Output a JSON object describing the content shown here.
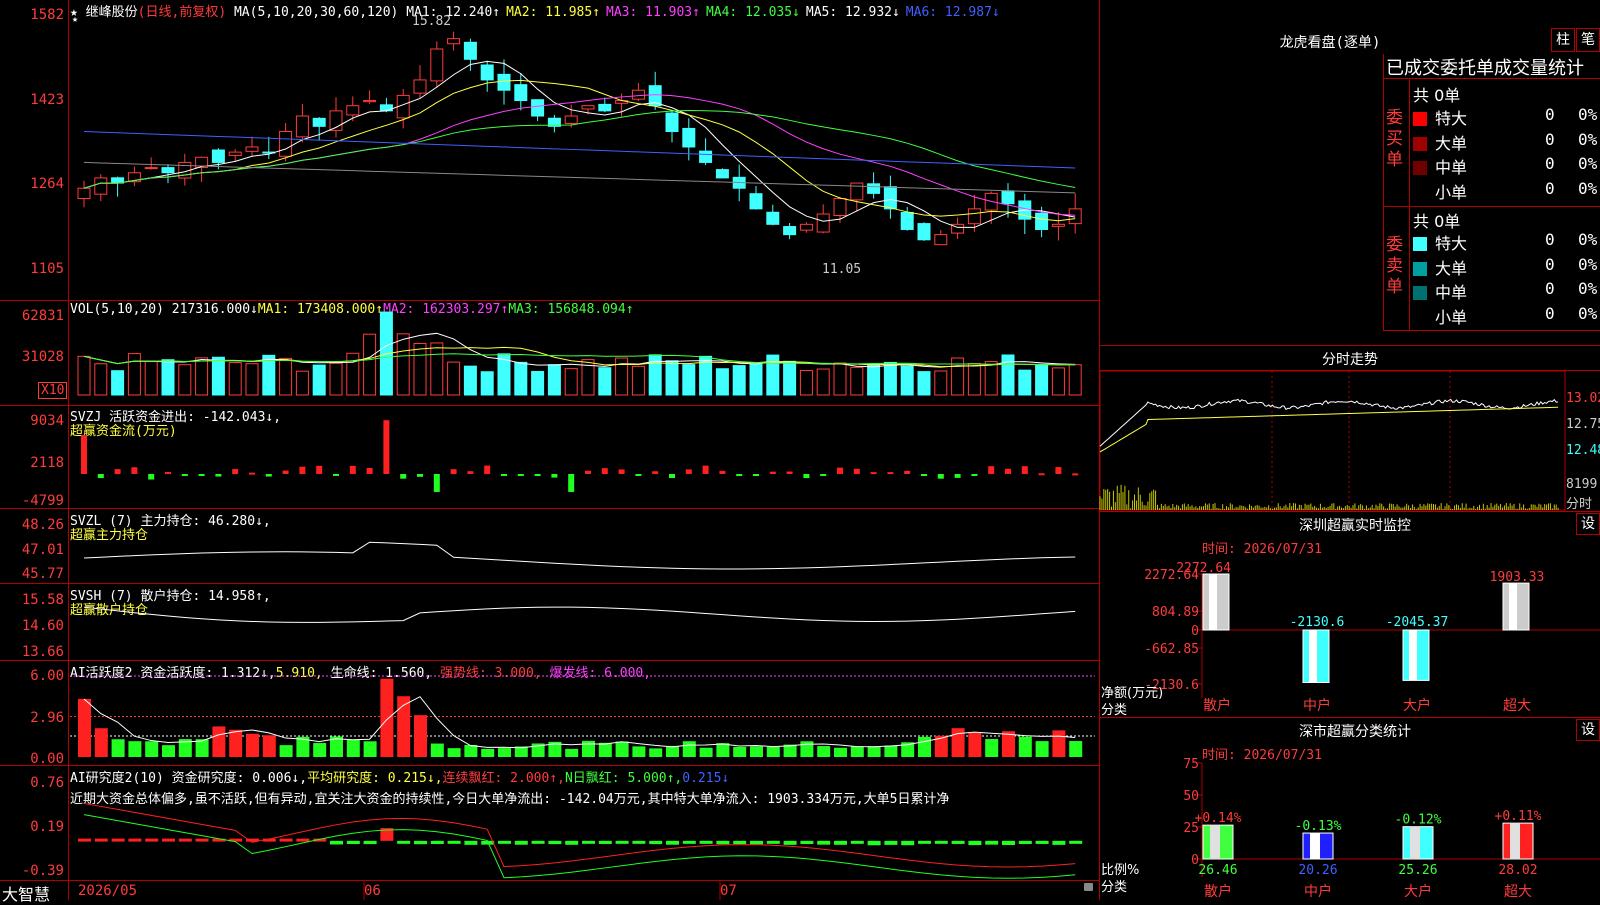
{
  "main": {
    "title": "继峰股份",
    "subtitle": "(日线,前复权)",
    "ma_header": {
      "label": "MA(5,10,20,30,60,120)",
      "items": [
        {
          "name": "MA1:",
          "value": "12.240↑",
          "color": "#ffffff"
        },
        {
          "name": "MA2:",
          "value": "11.985↑",
          "color": "#ffff40"
        },
        {
          "name": "MA3:",
          "value": "11.903↑",
          "color": "#ff40ff"
        },
        {
          "name": "MA4:",
          "value": "12.035↓",
          "color": "#40ff40"
        },
        {
          "name": "MA5:",
          "value": "12.932↓",
          "color": "#ffffff"
        },
        {
          "name": "MA6:",
          "value": "12.987↓",
          "color": "#4060ff"
        }
      ]
    },
    "y_ticks": [
      "1582",
      "1423",
      "1264",
      "1105"
    ],
    "high_label": "15.82",
    "low_label": "11.05"
  },
  "vol": {
    "header": {
      "label": "VOL(5,10,20)",
      "v": "217316.000↓",
      "ma1": "MA1: 173408.000↑",
      "ma2": "MA2: 162303.297↑",
      "ma3": "MA3: 156848.094↑"
    },
    "y_ticks": [
      "62831",
      "31028"
    ],
    "unit": "X10"
  },
  "svzj": {
    "label": "SVZJ",
    "desc": "活跃资金进出: -142.043↓,",
    "sub": "超赢资金流(万元)",
    "y_ticks": [
      "9034",
      "2118",
      "-4799"
    ]
  },
  "svzl": {
    "label": "SVZL (7)",
    "desc": "主力持仓: 46.280↓,",
    "sub": "超赢主力持仓",
    "y_ticks": [
      "48.26",
      "47.01",
      "45.77"
    ]
  },
  "svsh": {
    "label": "SVSH (7)",
    "desc": "散户持仓: 14.958↑,",
    "sub": "超赢散户持仓",
    "y_ticks": [
      "15.58",
      "14.60",
      "13.66"
    ]
  },
  "ai1": {
    "label": "AI活跃度2",
    "desc1": "资金活跃度: 1.312↓,",
    "desc2": "5.910,",
    "desc3": "生命线: 1.560,",
    "desc4": "强势线: 3.000,",
    "desc5": "爆发线: 6.000,",
    "y_ticks": [
      "6.00",
      "2.96",
      "0.00"
    ]
  },
  "ai2": {
    "label": "AI研究度2(10)",
    "desc1": "资金研究度: 0.006↓,",
    "desc2": "平均研究度: 0.215↓,",
    "desc3": "连续飘红: 2.000↑,",
    "desc4": "N日飘红: 5.000↑,",
    "desc5": "0.215↓",
    "comment": "近期大资金总体偏多,虽不活跃,但有异动,宜关注大资金的持续性,今日大单净流出: -142.04万元,其中特大单净流入: 1903.334万元,大单5日累计净",
    "y_ticks": [
      "0.76",
      "0.19",
      "-0.39"
    ]
  },
  "xaxis": {
    "labels": [
      "2026/05",
      "06",
      "07"
    ],
    "brand": "大智慧"
  },
  "dragon": {
    "title": "龙虎看盘(逐单)",
    "btn_zhu": "柱",
    "btn_bi": "笔",
    "table_title": "已成交委托单成交量统计",
    "buy_label": "委买单",
    "sell_label": "委卖单",
    "buy_total": "共 0单",
    "sell_total": "共 0单",
    "buy_rows": [
      {
        "name": "特大",
        "num": "0",
        "pct": "0%",
        "color": "#ff0000"
      },
      {
        "name": "大单",
        "num": "0",
        "pct": "0%",
        "color": "#a00000"
      },
      {
        "name": "中单",
        "num": "0",
        "pct": "0%",
        "color": "#700000"
      },
      {
        "name": "小单",
        "num": "0",
        "pct": "0%",
        "color": "#000000"
      }
    ],
    "sell_rows": [
      {
        "name": "特大",
        "num": "0",
        "pct": "0%",
        "color": "#40ffff"
      },
      {
        "name": "大单",
        "num": "0",
        "pct": "0%",
        "color": "#00a0a0"
      },
      {
        "name": "中单",
        "num": "0",
        "pct": "0%",
        "color": "#007070"
      },
      {
        "name": "小单",
        "num": "0",
        "pct": "0%",
        "color": "#000000"
      }
    ]
  },
  "intraday": {
    "title": "分时走势",
    "y_ticks": [
      "13.02",
      "12.75",
      "12.48"
    ],
    "vol_tick": "8199",
    "vol_label": "分时"
  },
  "monitor": {
    "title": "深圳超赢实时监控",
    "btn": "设",
    "time": "时间: 2026/07/31",
    "y_ticks": [
      "2272.64",
      "804.89",
      "0",
      "-662.85",
      "-2130.6"
    ],
    "ylabel": "净额(万元)",
    "xlabel": "分类",
    "bars": [
      {
        "cat": "散户",
        "value": "2272.64",
        "v": 2272.64
      },
      {
        "cat": "中户",
        "value": "-2130.6",
        "v": -2130.6
      },
      {
        "cat": "大户",
        "value": "-2045.37",
        "v": -2045.37
      },
      {
        "cat": "超大",
        "value": "1903.33",
        "v": 1903.33
      }
    ]
  },
  "classify": {
    "title": "深市超赢分类统计",
    "btn": "设",
    "time": "时间: 2026/07/31",
    "y_ticks": [
      "75",
      "50",
      "25",
      "0"
    ],
    "ylabel": "比例%",
    "xlabel": "分类",
    "bars": [
      {
        "cat": "散户",
        "pct": "+0.14%",
        "value": "26.46",
        "v": 26.46
      },
      {
        "cat": "中户",
        "pct": "-0.13%",
        "value": "20.26",
        "v": 20.26
      },
      {
        "cat": "大户",
        "pct": "-0.12%",
        "value": "25.26",
        "v": 25.26
      },
      {
        "cat": "超大",
        "pct": "+0.11%",
        "value": "28.02",
        "v": 28.02
      }
    ]
  }
}
